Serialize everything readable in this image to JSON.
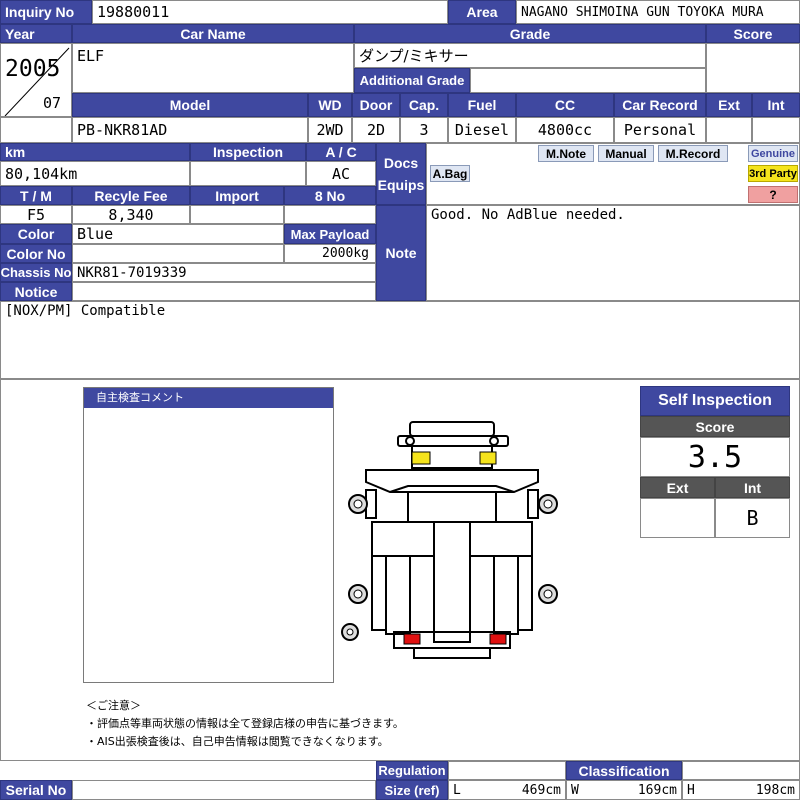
{
  "labels": {
    "inquiry_no": "Inquiry No",
    "area": "Area",
    "year": "Year",
    "car_name": "Car Name",
    "grade": "Grade",
    "score": "Score",
    "additional_grade": "Additional Grade",
    "model": "Model",
    "wd": "WD",
    "door": "Door",
    "cap": "Cap.",
    "fuel": "Fuel",
    "cc": "CC",
    "car_record": "Car Record",
    "ext": "Ext",
    "int": "Int",
    "km": "km",
    "inspection": "Inspection",
    "ac": "A / C",
    "docs": "Docs",
    "equips": "Equips",
    "tm": "T / M",
    "recycle_fee": "Recyle Fee",
    "import": "Import",
    "eight_no": "8 No",
    "color": "Color",
    "max_payload": "Max Payload",
    "color_no": "Color No",
    "chassis_no": "Chassis No",
    "notice": "Notice",
    "note": "Note",
    "serial_no": "Serial No",
    "regulation": "Regulation",
    "size_ref": "Size (ref)",
    "classification": "Classification",
    "len": "L",
    "width": "W",
    "height": "H"
  },
  "values": {
    "inquiry_no": "19880011",
    "area": "NAGANO SHIMOINA GUN TOYOKA MURA",
    "year": "2005",
    "month": "07",
    "car_name": "ELF",
    "grade": "ダンプ/ミキサー",
    "additional_grade": "",
    "score": "",
    "model": "PB-NKR81AD",
    "wd": "2WD",
    "door": "2D",
    "cap": "3",
    "fuel": "Diesel",
    "cc": "4800cc",
    "car_record": "Personal",
    "ext": "",
    "int": "",
    "km": "80,104km",
    "inspection": "",
    "ac": "AC",
    "tm": "F5",
    "recycle_fee": "8,340",
    "import": "",
    "eight_no": "",
    "color": "Blue",
    "max_payload": "2000kg",
    "color_no": "",
    "chassis_no": "NKR81-7019339",
    "notice": "[NOX/PM] Compatible",
    "note": "Good. No AdBlue needed.",
    "serial_no": "",
    "regulation": "",
    "length": "469cm",
    "width": "169cm",
    "height": "198cm"
  },
  "equips": {
    "m_note": "M.Note",
    "manual": "Manual",
    "m_record": "M.Record",
    "a_bag": "A.Bag",
    "genuine": "Genuine",
    "third_party": "3rd Party",
    "unknown": "?"
  },
  "inspection_panel": {
    "comment_title": "自主検査コメント",
    "title": "Self Inspection",
    "score_label": "Score",
    "score": "3.5",
    "ext_label": "Ext",
    "int_label": "Int",
    "ext": "",
    "int": "B"
  },
  "notes": {
    "heading": "＜ご注意＞",
    "line1": "・評価点等車両状態の情報は全て登録店様の申告に基づきます。",
    "line2": "・AIS出張検査後は、自己申告情報は閲覧できなくなります。"
  },
  "colors": {
    "header": "#3f48a0",
    "gray_header": "#555555",
    "damage_yellow": "#f5e41c",
    "damage_red": "#e01010"
  }
}
